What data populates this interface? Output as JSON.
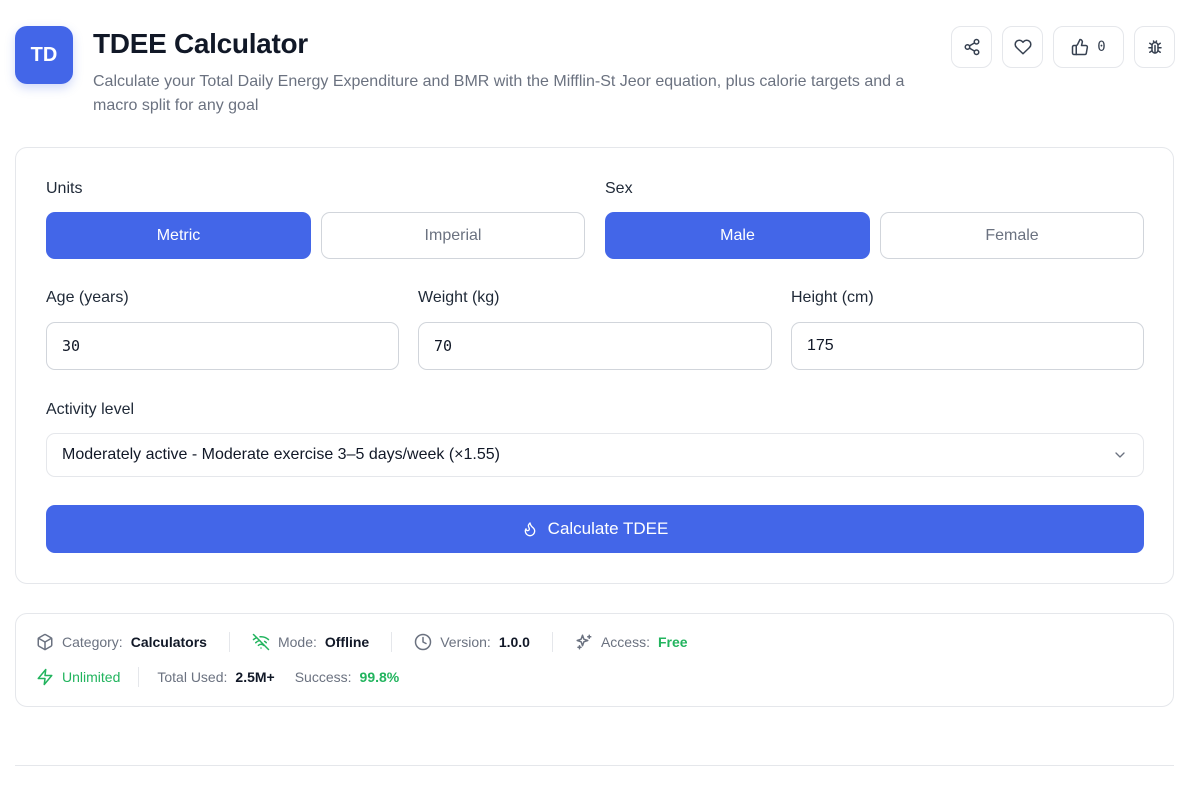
{
  "header": {
    "logo_text": "TD",
    "title": "TDEE Calculator",
    "description": "Calculate your Total Daily Energy Expenditure and BMR with the Mifflin-St Jeor equation, plus calorie targets and a macro split for any goal",
    "like_count": "0"
  },
  "form": {
    "units_label": "Units",
    "units_options": [
      "Metric",
      "Imperial"
    ],
    "units_selected": "Metric",
    "sex_label": "Sex",
    "sex_options": [
      "Male",
      "Female"
    ],
    "sex_selected": "Male",
    "age_label": "Age (years)",
    "age_value": "30",
    "weight_label": "Weight (kg)",
    "weight_value": "70",
    "height_label": "Height (cm)",
    "height_value": "175",
    "activity_label": "Activity level",
    "activity_value": "Moderately active - Moderate exercise 3–5 days/week (×1.55)",
    "calculate_label": "Calculate TDEE"
  },
  "meta": {
    "category_label": "Category:",
    "category_value": "Calculators",
    "mode_label": "Mode:",
    "mode_value": "Offline",
    "version_label": "Version:",
    "version_value": "1.0.0",
    "access_label": "Access:",
    "access_value": "Free",
    "limit_value": "Unlimited",
    "total_used_label": "Total Used:",
    "total_used_value": "2.5M+",
    "success_label": "Success:",
    "success_value": "99.8%"
  },
  "colors": {
    "accent": "#4366e8",
    "success": "#22b45e"
  },
  "icons": [
    "share-icon",
    "heart-icon",
    "thumbs-up-icon",
    "bug-icon",
    "flame-icon",
    "chevron-down-icon",
    "box-icon",
    "wifi-off-icon",
    "clock-icon",
    "sparkles-icon",
    "zap-icon"
  ]
}
